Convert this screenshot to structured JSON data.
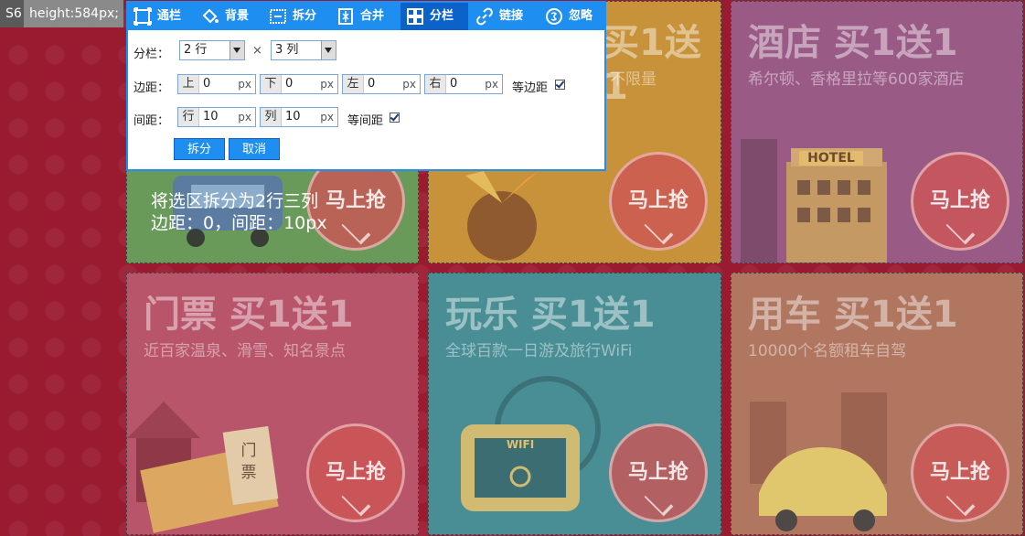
{
  "badges": {
    "selector": "S6",
    "style": "height:584px;"
  },
  "toolbar": [
    {
      "label": "通栏",
      "icon": "full-width-icon"
    },
    {
      "label": "背景",
      "icon": "paint-bucket-icon"
    },
    {
      "label": "拆分",
      "icon": "split-icon"
    },
    {
      "label": "合并",
      "icon": "merge-icon"
    },
    {
      "label": "分栏",
      "icon": "grid-icon"
    },
    {
      "label": "链接",
      "icon": "link-icon"
    },
    {
      "label": "忽略",
      "icon": "ignore-icon"
    }
  ],
  "form": {
    "columns_label": "分栏：",
    "rows_value": "2 行",
    "times": "×",
    "cols_value": "3 列",
    "margin_label": "边距：",
    "margins": [
      {
        "prefix": "上",
        "value": "0",
        "unit": "px"
      },
      {
        "prefix": "下",
        "value": "0",
        "unit": "px"
      },
      {
        "prefix": "左",
        "value": "0",
        "unit": "px"
      },
      {
        "prefix": "右",
        "value": "0",
        "unit": "px"
      }
    ],
    "equal_margin_label": "等边距",
    "spacing_label": "间距：",
    "spacings": [
      {
        "prefix": "行",
        "value": "10",
        "unit": "px"
      },
      {
        "prefix": "列",
        "value": "10",
        "unit": "px"
      }
    ],
    "equal_spacing_label": "等间距",
    "split_button": "拆分",
    "cancel_button": "取消"
  },
  "overlay": {
    "line1": "将选区拆分为2行三列",
    "line2": "边距：0，间距：10px"
  },
  "panels": [
    {
      "title": "",
      "subtitle": "",
      "cta": "马上抢",
      "color": "#6a9a5a"
    },
    {
      "title": "买1送1",
      "subtitle": "不限量",
      "cta": "马上抢",
      "color": "#c8923a"
    },
    {
      "title": "酒店 买1送1",
      "subtitle": "希尔顿、香格里拉等600家酒店",
      "cta": "马上抢",
      "color": "#9a5a86",
      "sign": "HOTEL"
    },
    {
      "title": "门票 买1送1",
      "subtitle": "近百家温泉、滑雪、知名景点",
      "cta": "马上抢",
      "color": "#b8556a",
      "ticket": "门票"
    },
    {
      "title": "玩乐 买1送1",
      "subtitle": "全球百款一日游及旅行WiFi",
      "cta": "马上抢",
      "color": "#4a8e95",
      "wifi": "WIFI"
    },
    {
      "title": "用车 买1送1",
      "subtitle": "10000个名额租车自驾",
      "cta": "马上抢",
      "color": "#b07660"
    }
  ]
}
